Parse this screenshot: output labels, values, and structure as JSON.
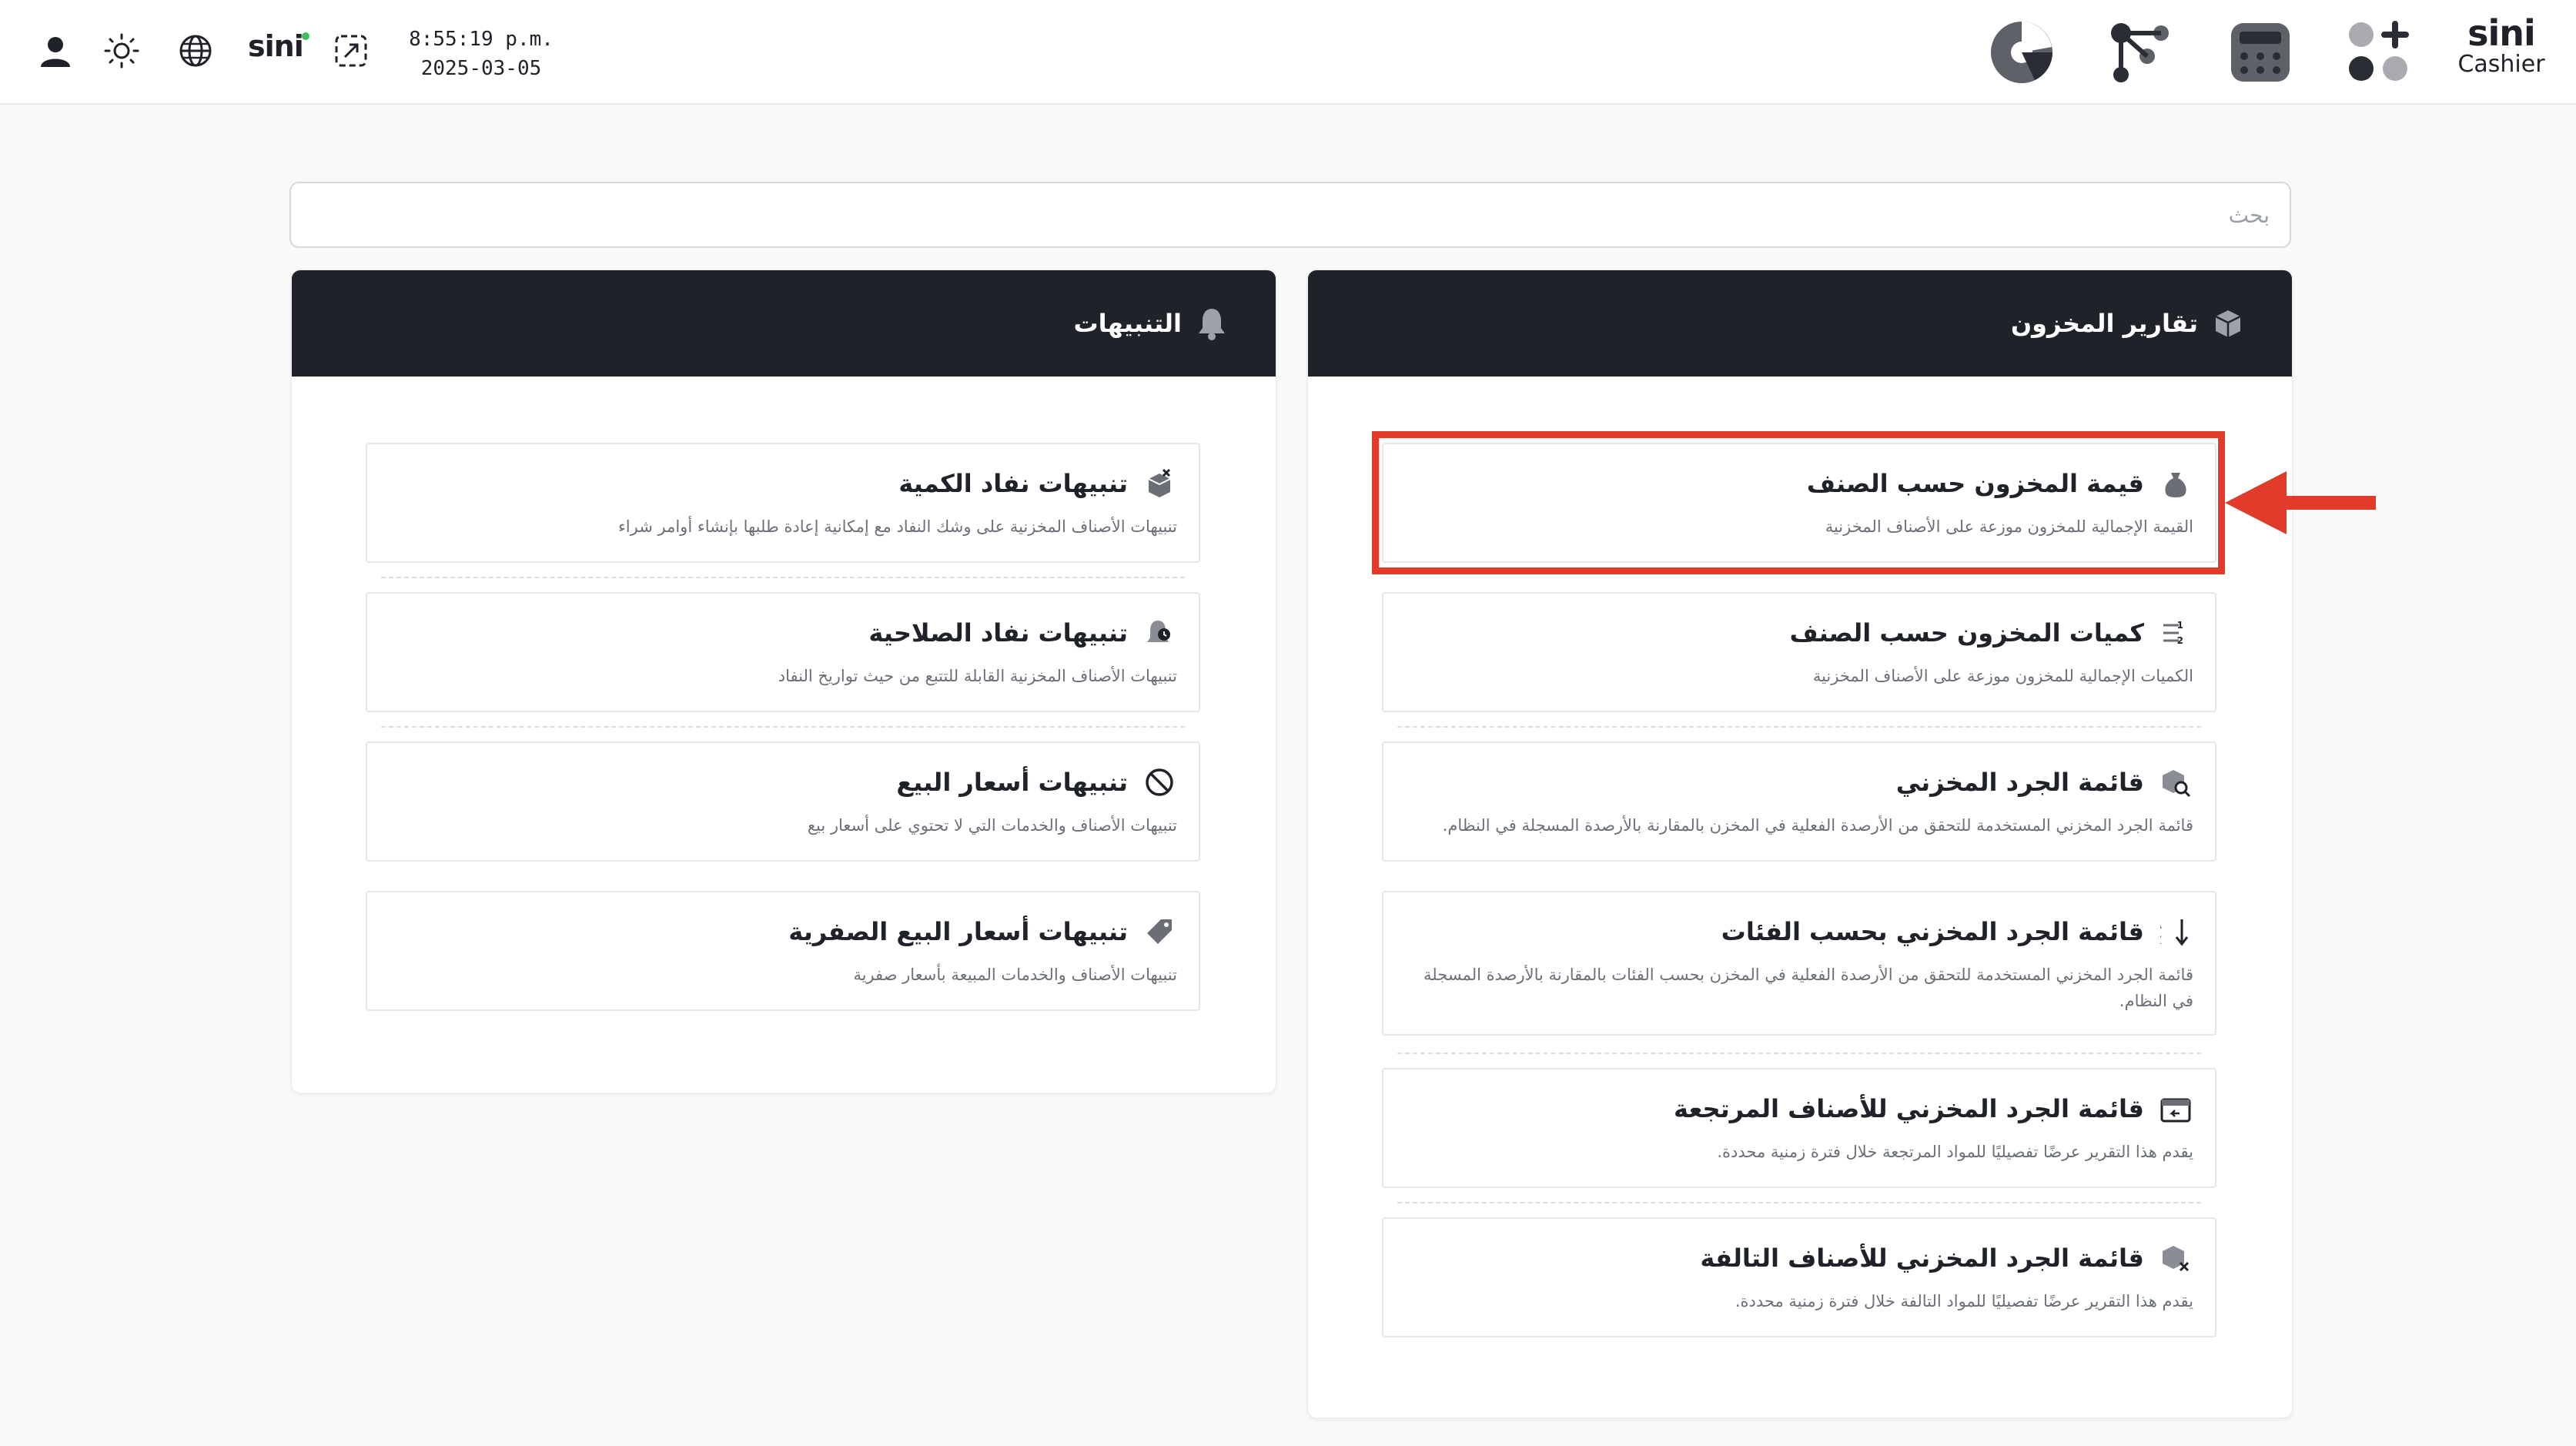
{
  "topbar": {
    "time": "8:55:19 p.m.",
    "date": "2025-03-05",
    "logo_small": "sini",
    "brand_top": "sini",
    "brand_bottom": "Cashier",
    "icons": [
      "user-icon",
      "brightness-icon",
      "globe-icon",
      "sini-logo",
      "fullscreen-icon",
      "pie-chart-icon",
      "workflow-icon",
      "calculator-icon",
      "apps-add-icon"
    ]
  },
  "search": {
    "placeholder": "بحث"
  },
  "alerts_panel": {
    "title": "التنبيهات",
    "icon": "bell-icon",
    "items": [
      {
        "title": "تنبيهات نفاد الكمية",
        "desc": "تنبيهات الأصناف المخزنية على وشك النفاد مع إمكانية إعادة طلبها بإنشاء أوامر شراء",
        "icon": "box-x-icon"
      },
      {
        "title": "تنبيهات نفاد الصلاحية",
        "desc": "تنبيهات الأصناف المخزنية القابلة للتتبع من حيث تواريخ النفاد",
        "icon": "bell-clock-icon"
      },
      {
        "title": "تنبيهات أسعار البيع",
        "desc": "تنبيهات الأصناف والخدمات التي لا تحتوي على أسعار بيع",
        "icon": "ban-icon"
      },
      {
        "title": "تنبيهات أسعار البيع الصفرية",
        "desc": "تنبيهات الأصناف والخدمات المبيعة بأسعار صفرية",
        "icon": "tag-icon"
      }
    ]
  },
  "inventory_panel": {
    "title": "تقارير المخزون",
    "icon": "package-icon",
    "items": [
      {
        "title": "قيمة المخزون حسب الصنف",
        "desc": "القيمة الإجمالية للمخزون موزعة على الأصناف المخزنية",
        "icon": "money-bag-icon"
      },
      {
        "title": "كميات المخزون حسب الصنف",
        "desc": "الكميات الإجمالية للمخزون موزعة على الأصناف المخزنية",
        "icon": "list-numbers-icon"
      },
      {
        "title": "قائمة الجرد المخزني",
        "desc": "قائمة الجرد المخزني المستخدمة للتحقق من الأرصدة الفعلية في المخزن بالمقارنة بالأرصدة المسجلة في النظام.",
        "icon": "box-search-icon"
      },
      {
        "title": "قائمة الجرد المخزني بحسب الفئات",
        "desc": "قائمة الجرد المخزني المستخدمة للتحقق من الأرصدة الفعلية في المخزن بحسب الفئات بالمقارنة بالأرصدة المسجلة في النظام.",
        "icon": "sort-az-icon"
      },
      {
        "title": "قائمة الجرد المخزني للأصناف المرتجعة",
        "desc": "يقدم هذا التقرير عرضًا تفصيليًا للمواد المرتجعة خلال فترة زمنية محددة.",
        "icon": "box-return-icon"
      },
      {
        "title": "قائمة الجرد المخزني للأصناف التالفة",
        "desc": "يقدم هذا التقرير عرضًا تفصيليًا للمواد التالفة خلال فترة زمنية محددة.",
        "icon": "box-damaged-icon"
      }
    ]
  },
  "colors": {
    "header_bg": "#1f2229",
    "highlight": "#e33b2a"
  }
}
